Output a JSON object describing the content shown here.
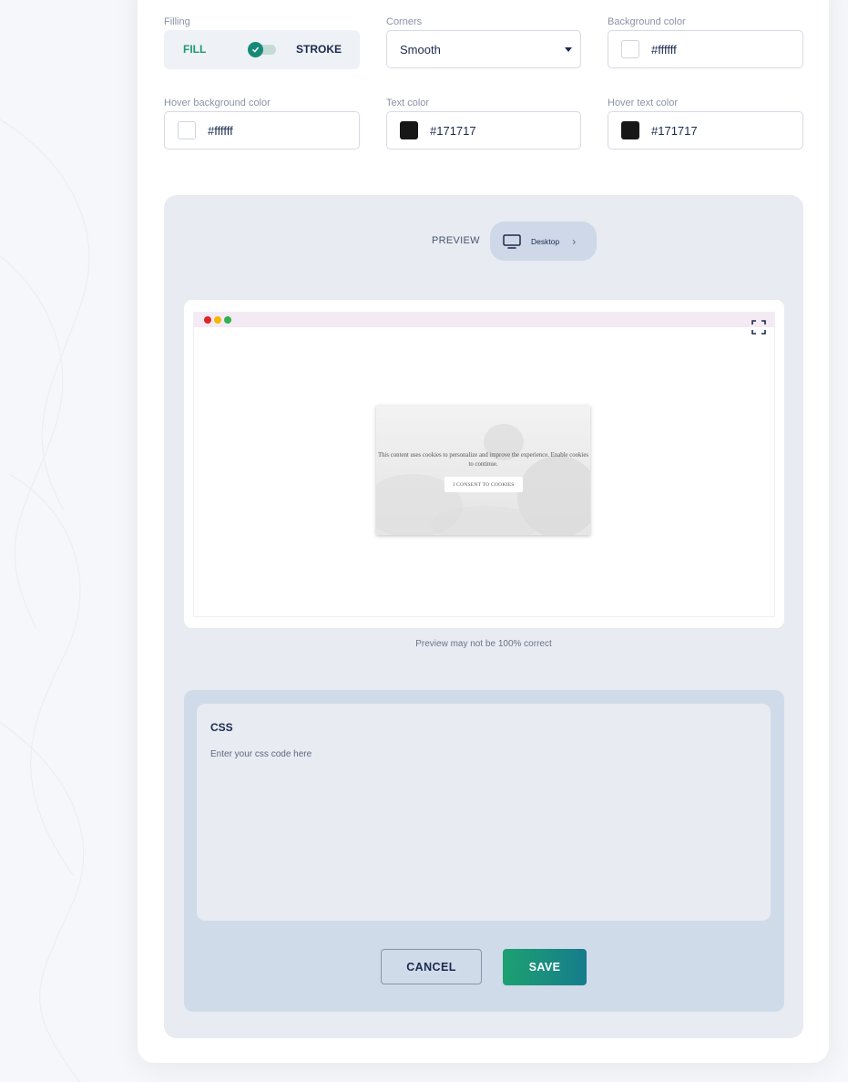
{
  "style_form": {
    "filling": {
      "label": "Filling",
      "fill_label": "FILL",
      "stroke_label": "STROKE",
      "checked": true
    },
    "corners": {
      "label": "Corners",
      "value": "Smooth"
    },
    "background_color": {
      "label": "Background color",
      "value": "#ffffff",
      "swatch": "#ffffff"
    },
    "hover_background_color": {
      "label": "Hover background color",
      "value": "#ffffff",
      "swatch": "#ffffff"
    },
    "text_color": {
      "label": "Text color",
      "value": "#171717",
      "swatch": "#171717"
    },
    "hover_text_color": {
      "label": "Hover text color",
      "value": "#171717",
      "swatch": "#171717"
    }
  },
  "preview": {
    "label": "PREVIEW",
    "device": "Desktop",
    "window_dots": [
      "#e02424",
      "#f5b800",
      "#2fb24c"
    ],
    "popup_text": "This content uses cookies to personalize and improve the experience. Enable cookies to continue.",
    "popup_button": "I CONSENT TO COOKIES",
    "note": "Preview may not be 100% correct"
  },
  "css_editor": {
    "title": "CSS",
    "placeholder": "Enter your css code here"
  },
  "actions": {
    "cancel": "CANCEL",
    "save": "SAVE"
  },
  "colors": {
    "accent_green": "#1da171",
    "accent_teal": "#167c8c",
    "navy": "#1b2a4e"
  }
}
